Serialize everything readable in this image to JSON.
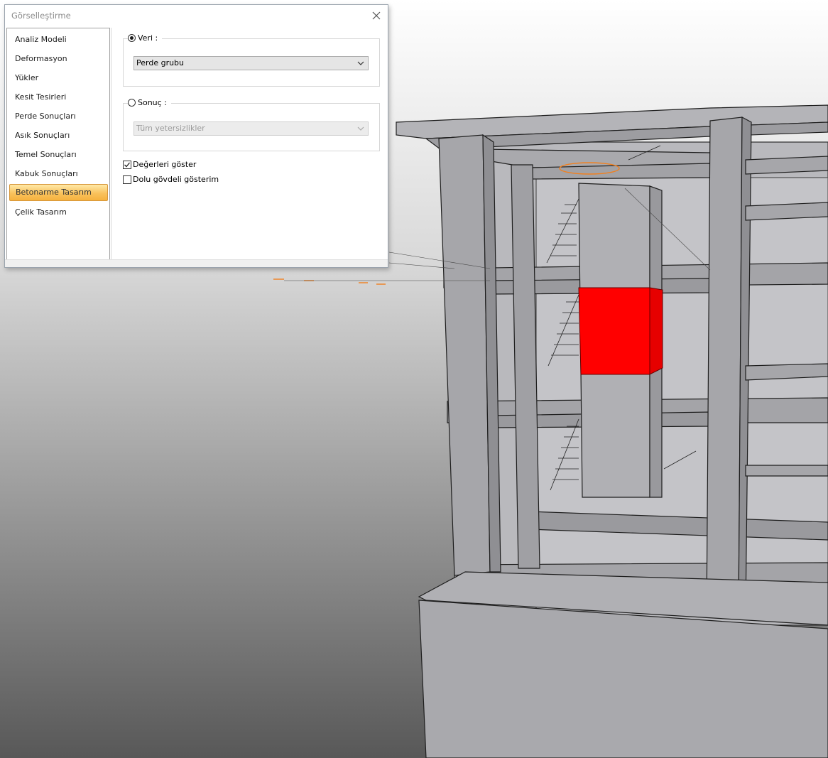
{
  "dialog": {
    "title": "Görselleştirme",
    "nav_items": [
      {
        "label": "Analiz Modeli",
        "active": false
      },
      {
        "label": "Deformasyon",
        "active": false
      },
      {
        "label": "Yükler",
        "active": false
      },
      {
        "label": "Kesit Tesirleri",
        "active": false
      },
      {
        "label": "Perde Sonuçları",
        "active": false
      },
      {
        "label": "Asık Sonuçları",
        "active": false
      },
      {
        "label": "Temel Sonuçları",
        "active": false
      },
      {
        "label": "Kabuk Sonuçları",
        "active": false
      },
      {
        "label": "Betonarme Tasarım",
        "active": true
      },
      {
        "label": "Çelik Tasarım",
        "active": false
      }
    ],
    "veri": {
      "label": "Veri :",
      "selected": true,
      "combo_value": "Perde grubu"
    },
    "sonuc": {
      "label": "Sonuç :",
      "selected": false,
      "combo_value": "Tüm yetersizlikler",
      "disabled": true
    },
    "show_values": {
      "label": "Değerleri göster",
      "checked": true
    },
    "solid_display": {
      "label": "Dolu gövdeli gösterim",
      "checked": false
    }
  },
  "scene": {
    "highlight_color": "#ff0000",
    "structure_color": "#a7a7ab"
  }
}
